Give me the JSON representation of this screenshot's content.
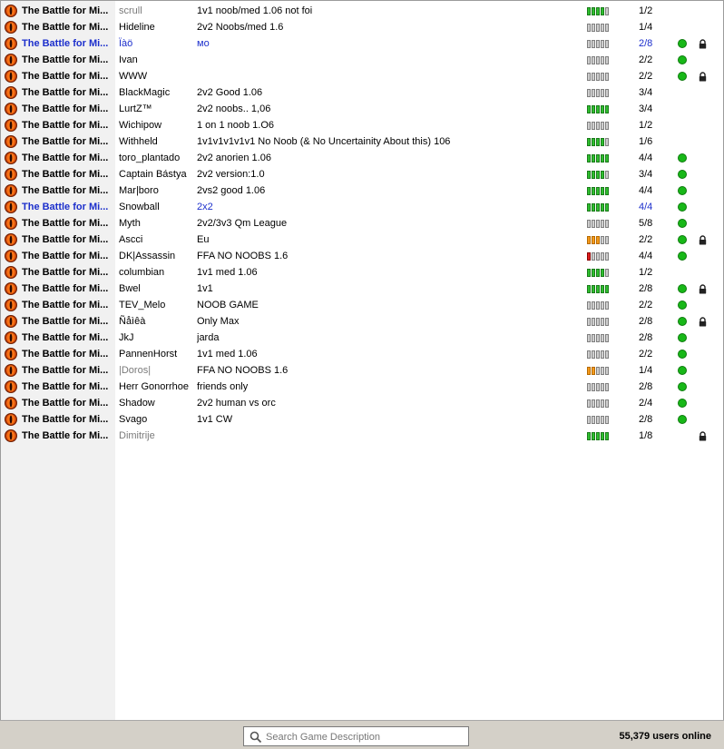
{
  "colors": {
    "status_green": "#18b818",
    "highlight_blue": "#1c2fcc",
    "dim_grey": "#7a7a7a",
    "bar_green": "#2fbf2f",
    "bar_orange": "#f59a1c",
    "bar_red": "#e02020"
  },
  "games": [
    {
      "game": "The Battle for Mi...",
      "host": "scrull",
      "desc": "1v1 noob/med 1.06 not foi",
      "bars": "gggg_",
      "players": "1/2",
      "online": false,
      "locked": false,
      "host_style": "grey",
      "desc_style": "",
      "name_style": "",
      "players_style": ""
    },
    {
      "game": "The Battle for Mi...",
      "host": "Hideline",
      "desc": "2v2 Noobs/med 1.6",
      "bars": "_____",
      "players": "1/4",
      "online": false,
      "locked": false,
      "host_style": "",
      "desc_style": "",
      "name_style": "",
      "players_style": ""
    },
    {
      "game": "The Battle for Mi...",
      "host": "Ïàö",
      "desc": "мо",
      "bars": "_____",
      "players": "2/8",
      "online": true,
      "locked": true,
      "host_style": "blue",
      "desc_style": "blue",
      "name_style": "blue",
      "players_style": "blue"
    },
    {
      "game": "The Battle for Mi...",
      "host": "Ivan",
      "desc": "",
      "bars": "_____",
      "players": "2/2",
      "online": true,
      "locked": false,
      "host_style": "",
      "desc_style": "",
      "name_style": "",
      "players_style": ""
    },
    {
      "game": "The Battle for Mi...",
      "host": "WWW",
      "desc": "",
      "bars": "_____",
      "players": "2/2",
      "online": true,
      "locked": true,
      "host_style": "",
      "desc_style": "",
      "name_style": "",
      "players_style": ""
    },
    {
      "game": "The Battle for Mi...",
      "host": "BlackMagic",
      "desc": "2v2 Good 1.06",
      "bars": "_____",
      "players": "3/4",
      "online": false,
      "locked": false,
      "host_style": "",
      "desc_style": "",
      "name_style": "",
      "players_style": ""
    },
    {
      "game": "The Battle for Mi...",
      "host": "LurtZ™",
      "desc": "2v2 noobs.. 1,06",
      "bars": "ggggg",
      "players": "3/4",
      "online": false,
      "locked": false,
      "host_style": "",
      "desc_style": "",
      "name_style": "",
      "players_style": ""
    },
    {
      "game": "The Battle for Mi...",
      "host": "Wichipow",
      "desc": "1 on 1 noob  1.O6",
      "bars": "_____",
      "players": "1/2",
      "online": false,
      "locked": false,
      "host_style": "",
      "desc_style": "",
      "name_style": "",
      "players_style": ""
    },
    {
      "game": "The Battle for Mi...",
      "host": "Withheld",
      "desc": "1v1v1v1v1v1   No Noob (& No Uncertainity About this)    106",
      "bars": "gggg_",
      "players": "1/6",
      "online": false,
      "locked": false,
      "host_style": "",
      "desc_style": "",
      "name_style": "",
      "players_style": ""
    },
    {
      "game": "The Battle for Mi...",
      "host": "toro_plantado",
      "desc": "2v2 anorien 1.06",
      "bars": "ggggg",
      "players": "4/4",
      "online": true,
      "locked": false,
      "host_style": "",
      "desc_style": "",
      "name_style": "",
      "players_style": ""
    },
    {
      "game": "The Battle for Mi...",
      "host": "Captain Bástya",
      "desc": "2v2 version:1.0",
      "bars": "gggg_",
      "players": "3/4",
      "online": true,
      "locked": false,
      "host_style": "",
      "desc_style": "",
      "name_style": "",
      "players_style": ""
    },
    {
      "game": "The Battle for Mi...",
      "host": "Mar|boro",
      "desc": "2vs2 good 1.06",
      "bars": "ggggg",
      "players": "4/4",
      "online": true,
      "locked": false,
      "host_style": "",
      "desc_style": "",
      "name_style": "",
      "players_style": ""
    },
    {
      "game": "The Battle for Mi...",
      "host": "Snowball",
      "desc": "2x2",
      "bars": "ggggg",
      "players": "4/4",
      "online": true,
      "locked": false,
      "host_style": "",
      "desc_style": "blue",
      "name_style": "blue",
      "players_style": "blue"
    },
    {
      "game": "The Battle for Mi...",
      "host": "Myth",
      "desc": "2v2/3v3 Qm League",
      "bars": "_____",
      "players": "5/8",
      "online": true,
      "locked": false,
      "host_style": "",
      "desc_style": "",
      "name_style": "",
      "players_style": ""
    },
    {
      "game": "The Battle for Mi...",
      "host": "Ascci",
      "desc": "Eu",
      "bars": "ooo__",
      "players": "2/2",
      "online": true,
      "locked": true,
      "host_style": "",
      "desc_style": "",
      "name_style": "",
      "players_style": ""
    },
    {
      "game": "The Battle for Mi...",
      "host": "DK|Assassin",
      "desc": "FFA NO NOOBS 1.6",
      "bars": "r____",
      "players": "4/4",
      "online": true,
      "locked": false,
      "host_style": "",
      "desc_style": "",
      "name_style": "",
      "players_style": ""
    },
    {
      "game": "The Battle for Mi...",
      "host": "columbian",
      "desc": "1v1 med 1.06",
      "bars": "gggg_",
      "players": "1/2",
      "online": false,
      "locked": false,
      "host_style": "",
      "desc_style": "",
      "name_style": "",
      "players_style": ""
    },
    {
      "game": "The Battle for Mi...",
      "host": "Bwel",
      "desc": "1v1",
      "bars": "ggggg",
      "players": "2/8",
      "online": true,
      "locked": true,
      "host_style": "",
      "desc_style": "",
      "name_style": "",
      "players_style": ""
    },
    {
      "game": "The Battle for Mi...",
      "host": "TEV_Melo",
      "desc": "NOOB GAME",
      "bars": "_____",
      "players": "2/2",
      "online": true,
      "locked": false,
      "host_style": "",
      "desc_style": "",
      "name_style": "",
      "players_style": ""
    },
    {
      "game": "The Battle for Mi...",
      "host": "Ñåìêà",
      "desc": "Only Max",
      "bars": "_____",
      "players": "2/8",
      "online": true,
      "locked": true,
      "host_style": "",
      "desc_style": "",
      "name_style": "",
      "players_style": ""
    },
    {
      "game": "The Battle for Mi...",
      "host": "JkJ",
      "desc": "jarda",
      "bars": "_____",
      "players": "2/8",
      "online": true,
      "locked": false,
      "host_style": "",
      "desc_style": "",
      "name_style": "",
      "players_style": ""
    },
    {
      "game": "The Battle for Mi...",
      "host": "PannenHorst",
      "desc": "1v1 med 1.06",
      "bars": "_____",
      "players": "2/2",
      "online": true,
      "locked": false,
      "host_style": "",
      "desc_style": "",
      "name_style": "",
      "players_style": ""
    },
    {
      "game": "The Battle for Mi...",
      "host": "|Doros|",
      "desc": "FFA NO NOOBS 1.6",
      "bars": "oo___",
      "players": "1/4",
      "online": true,
      "locked": false,
      "host_style": "grey",
      "desc_style": "",
      "name_style": "",
      "players_style": ""
    },
    {
      "game": "The Battle for Mi...",
      "host": "Herr Gonorrhoe",
      "desc": "friends only",
      "bars": "_____",
      "players": "2/8",
      "online": true,
      "locked": false,
      "host_style": "",
      "desc_style": "",
      "name_style": "",
      "players_style": ""
    },
    {
      "game": "The Battle for Mi...",
      "host": "Shadow",
      "desc": "2v2 human vs orc",
      "bars": "_____",
      "players": "2/4",
      "online": true,
      "locked": false,
      "host_style": "",
      "desc_style": "",
      "name_style": "",
      "players_style": ""
    },
    {
      "game": "The Battle for Mi...",
      "host": "Svago",
      "desc": "1v1 CW",
      "bars": "_____",
      "players": "2/8",
      "online": true,
      "locked": false,
      "host_style": "",
      "desc_style": "",
      "name_style": "",
      "players_style": ""
    },
    {
      "game": "The Battle for Mi...",
      "host": "Dimitrije",
      "desc": "",
      "bars": "ggggg",
      "players": "1/8",
      "online": false,
      "locked": true,
      "host_style": "grey",
      "desc_style": "",
      "name_style": "",
      "players_style": ""
    }
  ],
  "search": {
    "placeholder": "Search Game Description",
    "value": ""
  },
  "footer": {
    "users_online": "55,379 users online"
  },
  "icons": {
    "game_icon": "eye-of-sauron-icon",
    "search": "search-icon",
    "lock": "lock-icon",
    "status": "online-dot-icon"
  }
}
